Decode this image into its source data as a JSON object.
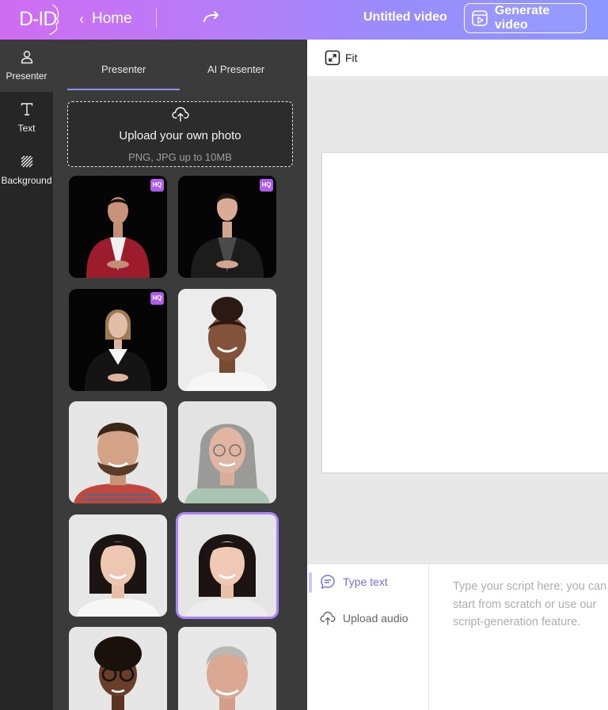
{
  "header": {
    "logo_text": "D-ID",
    "home_label": "Home",
    "video_title": "Untitled video",
    "generate_label": "Generate video"
  },
  "rail": {
    "items": [
      {
        "label": "Presenter",
        "icon": "person-icon"
      },
      {
        "label": "Text",
        "icon": "text-icon"
      },
      {
        "label": "Background",
        "icon": "hatch-icon"
      }
    ]
  },
  "panel": {
    "tabs": [
      {
        "label": "Presenter"
      },
      {
        "label": "AI Presenter"
      }
    ],
    "upload": {
      "title": "Upload your own photo",
      "subtitle": "PNG, JPG up to 10MB"
    },
    "presenters": [
      {
        "name": "man-red-jacket",
        "hq": "HQ"
      },
      {
        "name": "man-black-jacket",
        "hq": "HQ"
      },
      {
        "name": "woman-black-suit",
        "hq": "HQ"
      },
      {
        "name": "woman-curly-bun"
      },
      {
        "name": "bearded-man"
      },
      {
        "name": "grey-haired-woman"
      },
      {
        "name": "asian-woman-white-top"
      },
      {
        "name": "asian-woman-selected"
      },
      {
        "name": "woman-glasses"
      },
      {
        "name": "grey-haired-man"
      }
    ]
  },
  "canvas": {
    "fit_label": "Fit"
  },
  "script": {
    "type_text_label": "Type text",
    "upload_audio_label": "Upload audio",
    "placeholder_lines": [
      "Type your script here; you can",
      "start from scratch or use our",
      "script-generation feature."
    ]
  },
  "colors": {
    "accent": "#6f6fe9",
    "hq_badge": "#b05bea",
    "panel_bg": "#3b3b3b",
    "rail_bg": "#262626"
  }
}
